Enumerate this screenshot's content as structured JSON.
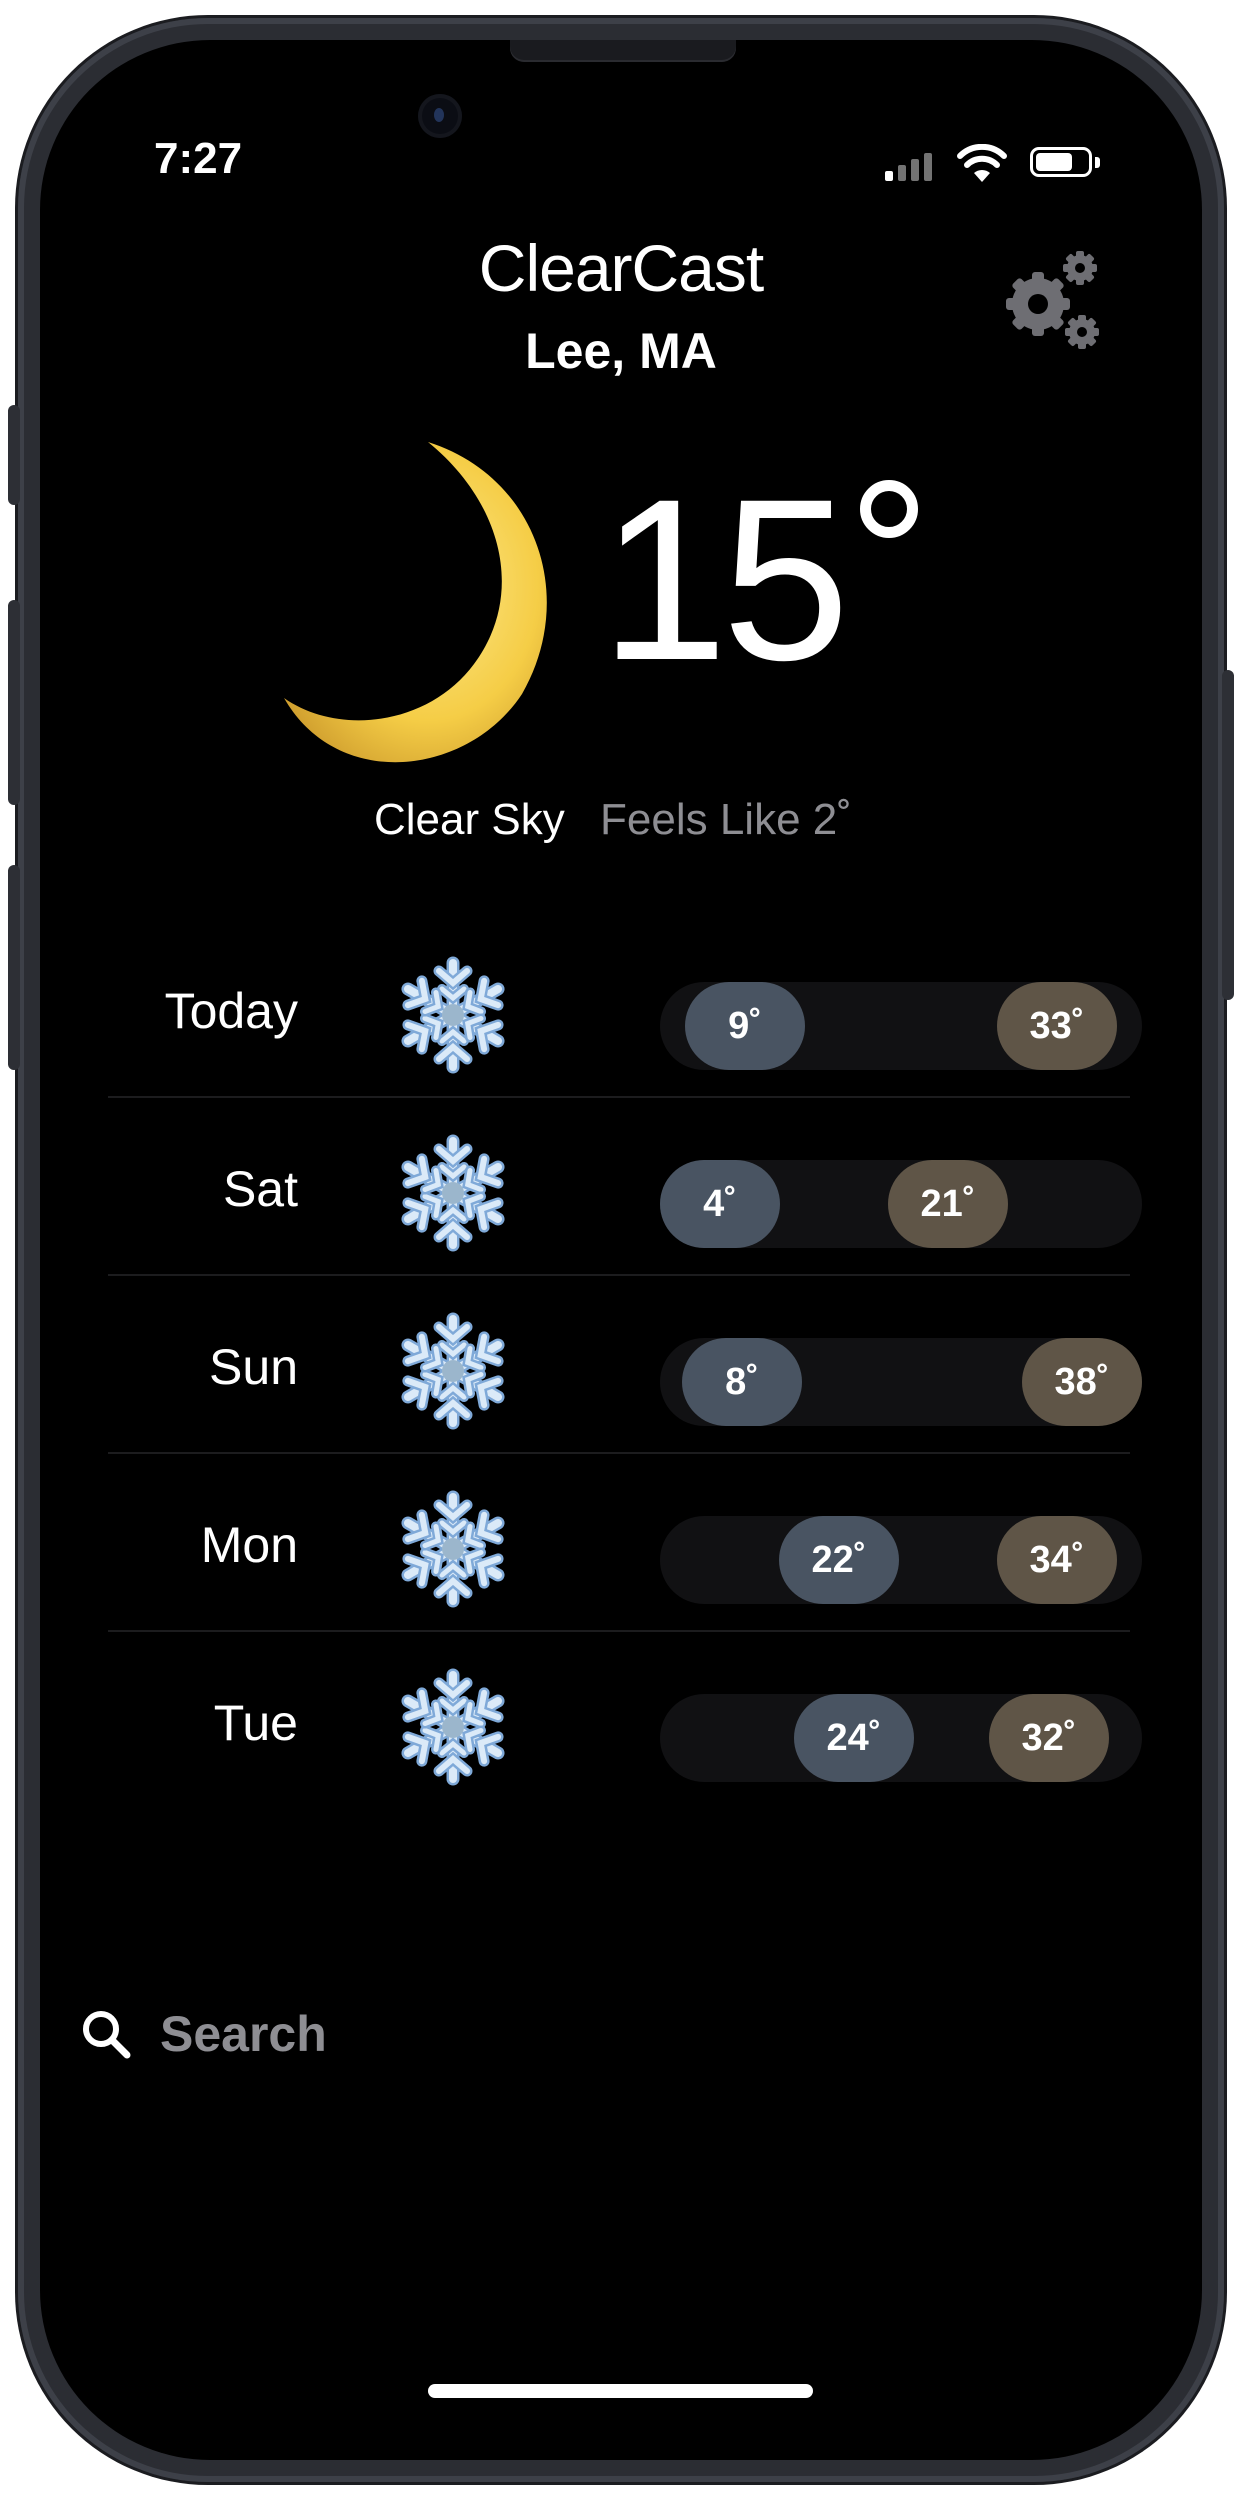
{
  "status_bar": {
    "time": "7:27",
    "signal_icon": "cellular-signal-icon",
    "wifi_icon": "wifi-icon",
    "battery_icon": "battery-icon"
  },
  "header": {
    "app_title": "ClearCast",
    "location": "Lee, MA",
    "settings_icon": "gears-icon"
  },
  "current": {
    "icon": "crescent-moon-icon",
    "temperature": "15",
    "condition": "Clear Sky",
    "feels_like": "Feels Like 2˚"
  },
  "forecast": [
    {
      "day": "Today",
      "icon": "snowflake-icon",
      "low": "9˚",
      "high": "33˚",
      "low_pos": 0.07,
      "high_pos": 0.93
    },
    {
      "day": "Sat",
      "icon": "snowflake-icon",
      "low": "4˚",
      "high": "21˚",
      "low_pos": 0.0,
      "high_pos": 0.63
    },
    {
      "day": "Sun",
      "icon": "snowflake-icon",
      "low": "8˚",
      "high": "38˚",
      "low_pos": 0.06,
      "high_pos": 1.0
    },
    {
      "day": "Mon",
      "icon": "snowflake-icon",
      "low": "22˚",
      "high": "34˚",
      "low_pos": 0.33,
      "high_pos": 0.93
    },
    {
      "day": "Tue",
      "icon": "snowflake-icon",
      "low": "24˚",
      "high": "32˚",
      "low_pos": 0.37,
      "high_pos": 0.91
    }
  ],
  "search": {
    "label": "Search",
    "icon": "search-icon"
  },
  "colors": {
    "background": "#000000",
    "low_pill": "#495462",
    "high_pill": "#5f5547",
    "moon": "#f6cf4e"
  }
}
